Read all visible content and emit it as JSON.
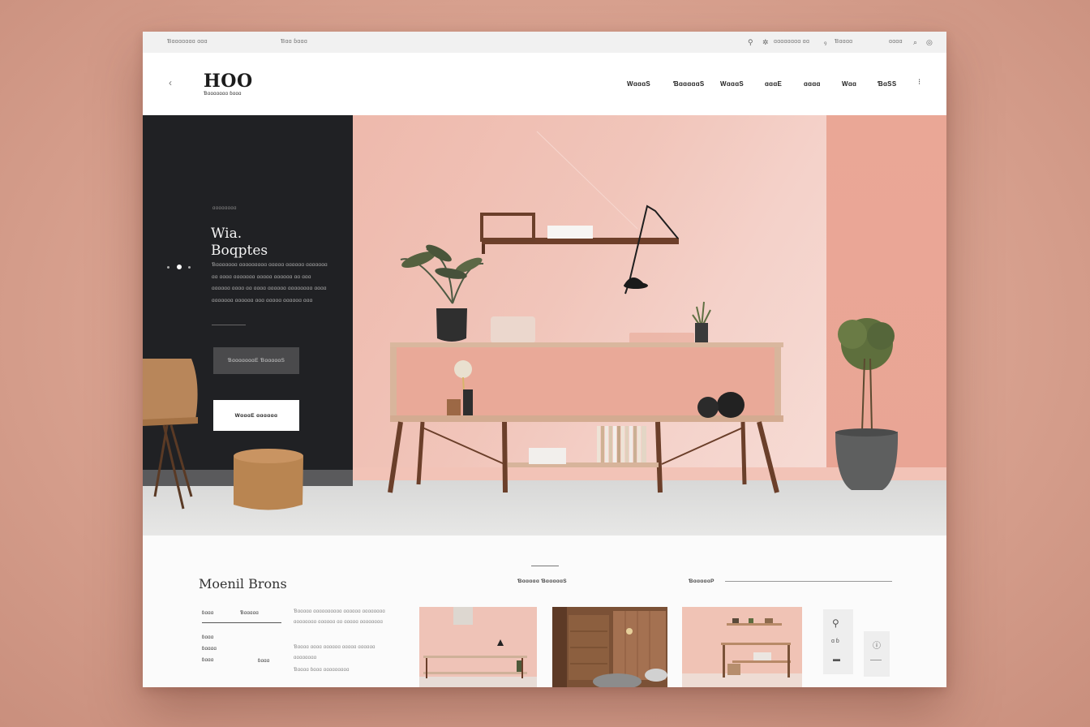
{
  "utilbar": {
    "left_text": "Ɓɑɑɑɑɑɑɑ ɑɑɑ",
    "mid_text": "Ɓɑɑ ɓɑɑɑ",
    "links": [
      "ɑɑɑɑɑɑɑɑ ɑɑ",
      "Ɓɑɑɑɑ",
      "ɑɑɑɑ"
    ],
    "icons": [
      "link-icon",
      "settings-icon",
      "user-icon",
      "search-icon",
      "cart-icon"
    ]
  },
  "header": {
    "logo": "HOO",
    "tagline": "Ɓɑɑɑɑɑɑɑ ɓɑɑɑ",
    "nav": [
      "WɑɑɑS",
      "ƁɑɑɑɑɑS",
      "WɑɑɑS",
      "ɑɑɑE",
      "ɑɑɑɑ",
      "Wɑɑ",
      "ƁɑSS"
    ],
    "more_label": "⁝"
  },
  "hero": {
    "eyebrow": "ɑɑɑɑɑɑɑɑ",
    "title_line1": "Wia.",
    "title_line2": "Boqptes",
    "body": "Ɓɑɑɑɑɑɑɑ ɑɑɑɑɑɑɑɑɑ ɑɑɑɑɑ ɑɑɑɑɑɑ ɑɑɑɑɑɑɑ ɑɑ ɑɑɑɑ ɑɑɑɑɑɑɑ ɑɑɑɑɑ ɑɑɑɑɑɑ ɑɑ ɑɑɑ ɑɑɑɑɑɑ ɑɑɑɑ ɑɑ ɑɑɑɑ ɑɑɑɑɑɑ ɑɑɑɑɑɑɑɑ ɑɑɑɑ ɑɑɑɑɑɑɑ ɑɑɑɑɑɑ ɑɑɑ ɑɑɑɑɑ ɑɑɑɑɑɑ ɑɑɑ",
    "button_secondary": "ƁɑɑɑɑɑɑɑE ƁɑɑɑɑɑS",
    "button_primary": "WɑɑɑE ɑɑɑɑɑɑ"
  },
  "lower": {
    "section_title": "Moenil Brons",
    "mid_label": "Ɓɑɑɑɑɑ ƁɑɑɑɑɑS",
    "right_label": "ƁɑɑɑɑɑP",
    "table_headers": [
      "ɓɑɑɑ",
      "Ɓɑɑɑɑɑ"
    ],
    "table_rows": [
      [
        "ɓɑɑɑ",
        ""
      ],
      [
        "ɓɑɑɑɑ",
        ""
      ],
      [
        "ɓɑɑɑ",
        "ɓɑɑɑ"
      ]
    ],
    "para1": "Ɓɑɑɑɑɑ ɑɑɑɑɑɑɑɑɑɑ ɑɑɑɑɑɑ ɑɑɑɑɑɑɑɑ ɑɑɑɑɑɑɑɑ ɑɑɑɑɑɑ ɑɑ ɑɑɑɑɑ ɑɑɑɑɑɑɑɑ",
    "para2": "Ɓɑɑɑɑ ɑɑɑɑ ɑɑɑɑɑɑ ɑɑɑɑɑ ɑɑɑɑɑɑ ɑɑɑɑɑɑɑɑ",
    "para3": "Ɓɑɑɑɑ ɓɑɑɑ ɑɑɑɑɑɑɑɑɑ",
    "side_icons": [
      "map-pin-icon",
      "bookmark-icon",
      "info-icon"
    ],
    "side_small_text": "ɑ ɓ"
  },
  "colors": {
    "page_bg": "#d9a290",
    "dark_panel": "#202124",
    "accent_pink": "#eeb9ac",
    "wood": "#6b3f2a"
  }
}
